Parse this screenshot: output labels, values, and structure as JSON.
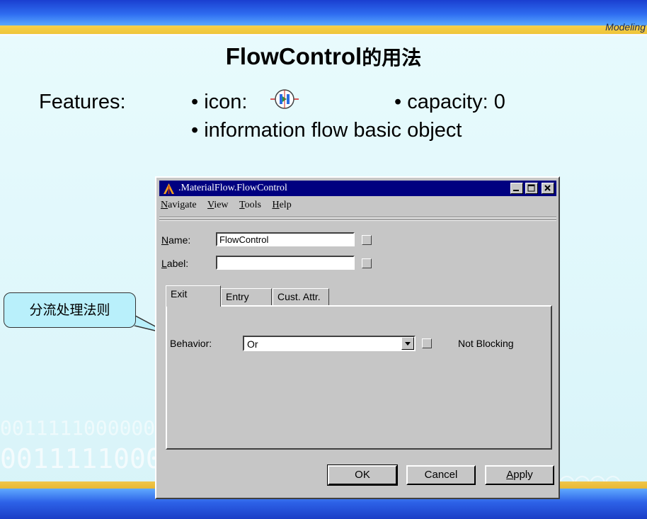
{
  "slide": {
    "section_label": "Modeling",
    "title_en": "FlowControl",
    "title_cn": "的用法",
    "features_label": "Features:",
    "bullet_icon": "• icon:",
    "bullet_capacity": "• capacity: 0",
    "bullet_info": "• information flow basic object",
    "icon_name": "flowcontrol-icon",
    "binary_line1": "0011111000000",
    "binary_line2": "00111110000",
    "callout_text": "分流处理法则"
  },
  "dialog": {
    "title": ".MaterialFlow.FlowControl",
    "menu": [
      {
        "pre": "",
        "u": "N",
        "post": "avigate"
      },
      {
        "pre": "",
        "u": "V",
        "post": "iew"
      },
      {
        "pre": "",
        "u": "T",
        "post": "ools"
      },
      {
        "pre": "",
        "u": "H",
        "post": "elp"
      }
    ],
    "name_label_u": "N",
    "name_label_rest": "ame:",
    "name_value": "FlowControl",
    "label_label_u": "L",
    "label_label_rest": "abel:",
    "label_value": "",
    "tabs": [
      "Exit",
      "Entry",
      "Cust. Attr."
    ],
    "behavior_label": "Behavior:",
    "behavior_value": "Or",
    "blocking_text": "Not Blocking",
    "buttons": {
      "ok": "OK",
      "cancel": "Cancel",
      "apply": "Apply"
    }
  },
  "colors": {
    "titlebar": "#000080",
    "dialog_face": "#c6c6c6",
    "callout_fill": "#b9f0fb",
    "slide_band": "#2e6cf0",
    "slide_stripe": "#eec43a"
  }
}
